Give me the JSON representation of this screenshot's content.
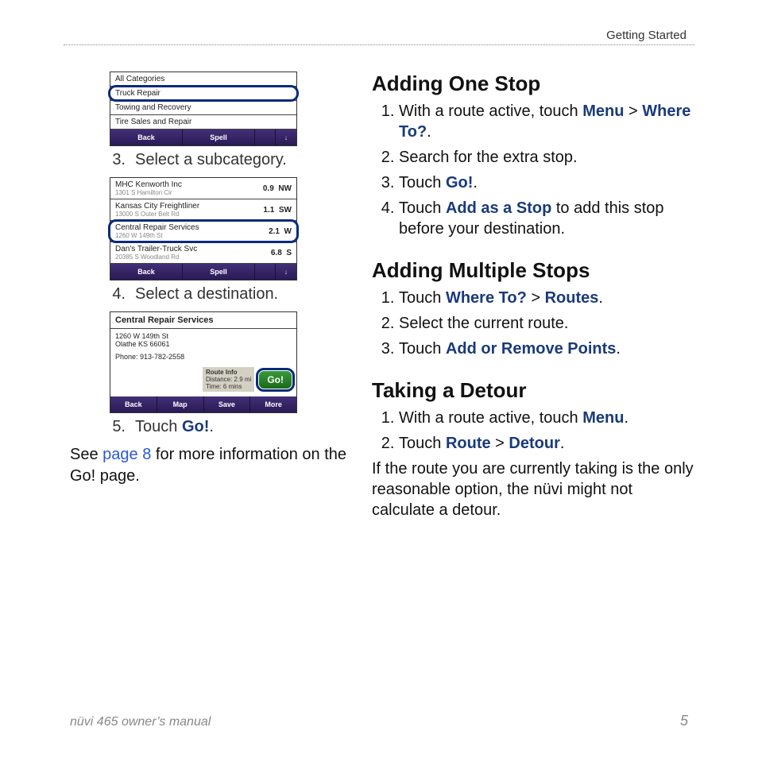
{
  "header": {
    "section": "Getting Started"
  },
  "footer": {
    "left": "nüvi 465 owner’s manual",
    "right": "5"
  },
  "shot1": {
    "rows": [
      "All Categories",
      "Truck Repair",
      "Towing and Recovery",
      "Tire Sales and Repair"
    ],
    "btns": {
      "back": "Back",
      "spell": "Spell",
      "down": "↓"
    }
  },
  "step3": {
    "num": "3.",
    "txt_a": "Select a subcategory."
  },
  "shot2": {
    "rows": [
      {
        "name": "MHC Kenworth Inc",
        "addr": "1301 S Hamilton Cir",
        "dist": "0.9",
        "dir": "NW"
      },
      {
        "name": "Kansas City Freightliner",
        "addr": "13000 S Outer Belt Rd",
        "dist": "1.1",
        "dir": "SW"
      },
      {
        "name": "Central Repair Services",
        "addr": "1260 W 149th St",
        "dist": "2.1",
        "dir": "W"
      },
      {
        "name": "Dan's Trailer-Truck Svc",
        "addr": "20385 S Woodland Rd",
        "dist": "6.8",
        "dir": "S"
      }
    ],
    "btns": {
      "back": "Back",
      "spell": "Spell",
      "down": "↓"
    }
  },
  "step4": {
    "num": "4.",
    "txt_a": "Select a destination."
  },
  "shot3": {
    "title": "Central Repair Services",
    "addr1": "1260 W 149th St",
    "addr2": "Olathe KS 66061",
    "phone": "Phone: 913-782-2558",
    "route_label": "Route Info",
    "route_dist": "Distance: 2.9 mi",
    "route_time": "Time: 6 mins",
    "go": "Go!",
    "btns": {
      "back": "Back",
      "map": "Map",
      "save": "Save",
      "more": "More"
    }
  },
  "step5": {
    "num": "5.",
    "txt_a": "Touch ",
    "go": "Go!",
    "txt_b": "."
  },
  "see": {
    "a": "See ",
    "link": "page 8",
    "b": " for more information on the Go! page."
  },
  "r1_title": "Adding One Stop",
  "r1_s1_a": "With a route active, touch ",
  "r1_s1_b1": "Menu",
  "r1_s1_gt": " > ",
  "r1_s1_b2": "Where To?",
  "r1_s1_c": ".",
  "r1_s2": "Search for the extra stop.",
  "r1_s3_a": "Touch ",
  "r1_s3_b": "Go!",
  "r1_s3_c": ".",
  "r1_s4_a": "Touch ",
  "r1_s4_b": "Add as a Stop",
  "r1_s4_c": " to add this stop before your destination.",
  "r2_title": "Adding Multiple Stops",
  "r2_s1_a": "Touch ",
  "r2_s1_b1": "Where To?",
  "r2_s1_gt": " > ",
  "r2_s1_b2": "Routes",
  "r2_s1_c": ".",
  "r2_s2": "Select the current route.",
  "r2_s3_a": "Touch ",
  "r2_s3_b": "Add or Remove Points",
  "r2_s3_c": ".",
  "r3_title": "Taking a Detour",
  "r3_s1_a": "With a route active, touch ",
  "r3_s1_b": "Menu",
  "r3_s1_c": ".",
  "r3_s2_a": "Touch ",
  "r3_s2_b1": "Route",
  "r3_s2_gt": " > ",
  "r3_s2_b2": "Detour",
  "r3_s2_c": ".",
  "r3_note": "If the route you are currently taking is the only reasonable option, the nüvi might not calculate a detour."
}
